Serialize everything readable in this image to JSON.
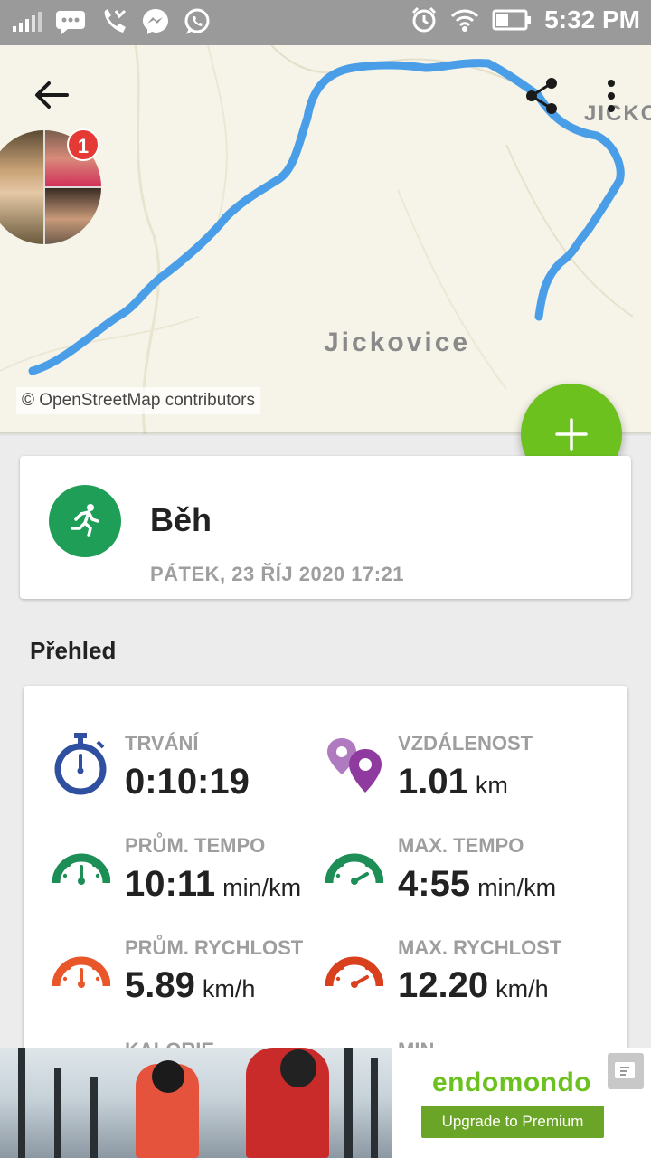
{
  "status_bar": {
    "time": "5:32 PM"
  },
  "map": {
    "town_label": "Jickovice",
    "edge_label": "JICKO",
    "attribution": "© OpenStreetMap contributors",
    "route_color": "#4a9ee8"
  },
  "notifications": {
    "badge_count": "1"
  },
  "workout": {
    "sport": "Běh",
    "date": "PÁTEK, 23 ŘÍJ 2020 17:21",
    "sport_icon": "running-icon",
    "accent": "#1e9e57"
  },
  "overview": {
    "title": "Přehled",
    "stats": [
      {
        "label": "TRVÁNÍ",
        "value": "0:10:19",
        "unit": "",
        "icon": "stopwatch-icon"
      },
      {
        "label": "VZDÁLENOST",
        "value": "1.01",
        "unit": "km",
        "icon": "distance-pins-icon"
      },
      {
        "label": "PRŮM. TEMPO",
        "value": "10:11",
        "unit": "min/km",
        "icon": "avg-pace-gauge-icon"
      },
      {
        "label": "MAX. TEMPO",
        "value": "4:55",
        "unit": "min/km",
        "icon": "max-pace-gauge-icon"
      },
      {
        "label": "PRŮM. RYCHLOST",
        "value": "5.89",
        "unit": "km/h",
        "icon": "avg-speed-gauge-icon"
      },
      {
        "label": "MAX. RYCHLOST",
        "value": "12.20",
        "unit": "km/h",
        "icon": "max-speed-gauge-icon"
      }
    ],
    "cut_labels": [
      "KALORIE",
      "MIN"
    ]
  },
  "ad": {
    "brand": "endomondo",
    "cta": "Upgrade to Premium"
  },
  "colors": {
    "fab": "#6cc11f",
    "pace_green": "#1e8e57",
    "speed_orange": "#e8562a",
    "stopwatch_blue": "#2f4fa0",
    "pin_purple": "#8e3a9e"
  }
}
